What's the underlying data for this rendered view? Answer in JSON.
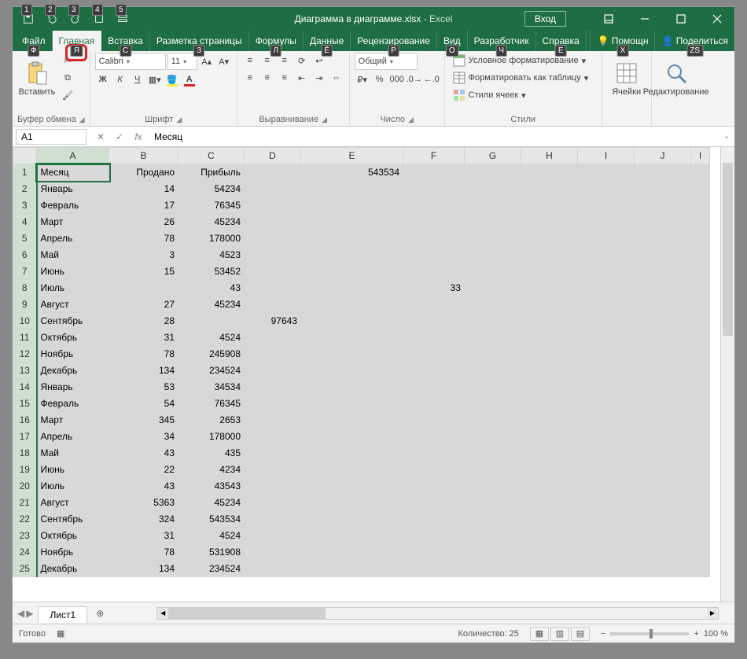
{
  "title": {
    "doc": "Диаграмма в диаграмме.xlsx",
    "sep": "  -  ",
    "app": "Excel"
  },
  "login": "Вход",
  "qat_keys": [
    "1",
    "2",
    "3",
    "4",
    "5"
  ],
  "tabs": [
    {
      "label": "Файл",
      "key": "Ф"
    },
    {
      "label": "Главная",
      "key": "Я",
      "active": true,
      "hl": true
    },
    {
      "label": "Вставка",
      "key": "С"
    },
    {
      "label": "Разметка страницы",
      "key": "З"
    },
    {
      "label": "Формулы",
      "key": "Л"
    },
    {
      "label": "Данные",
      "key": "Ё"
    },
    {
      "label": "Рецензирование",
      "key": "Р"
    },
    {
      "label": "Вид",
      "key": "О"
    },
    {
      "label": "Разработчик",
      "key": "Ч"
    },
    {
      "label": "Справка",
      "key": "Е"
    }
  ],
  "tabs_right": [
    {
      "label": "Помощн",
      "key": "Х",
      "icon": "bulb"
    },
    {
      "label": "Поделиться",
      "key": "ZS",
      "icon": "share"
    }
  ],
  "ribbon": {
    "clipboard": {
      "paste": "Вставить",
      "label": "Буфер обмена"
    },
    "font": {
      "name": "Calibri",
      "size": "11",
      "label": "Шрифт",
      "bold": "Ж",
      "italic": "К",
      "underline": "Ч"
    },
    "align": {
      "label": "Выравнивание"
    },
    "number": {
      "format": "Общий",
      "label": "Число"
    },
    "styles": {
      "cond": "Условное форматирование",
      "table": "Форматировать как таблицу",
      "cell": "Стили ячеек",
      "label": "Стили"
    },
    "cells": {
      "label": "Ячейки"
    },
    "editing": {
      "label": "Редактирование"
    }
  },
  "namebox": "A1",
  "formula": "Месяц",
  "columns": [
    "A",
    "B",
    "C",
    "D",
    "E",
    "F",
    "G",
    "H",
    "I",
    "J",
    "I"
  ],
  "rows": [
    [
      "Месяц",
      "Продано",
      "Прибыль",
      "",
      "543534",
      "",
      "",
      "",
      "",
      "",
      ""
    ],
    [
      "Январь",
      "14",
      "54234",
      "",
      "",
      "",
      "",
      "",
      "",
      "",
      ""
    ],
    [
      "Февраль",
      "17",
      "76345",
      "",
      "",
      "",
      "",
      "",
      "",
      "",
      ""
    ],
    [
      "Март",
      "26",
      "45234",
      "",
      "",
      "",
      "",
      "",
      "",
      "",
      ""
    ],
    [
      "Апрель",
      "78",
      "178000",
      "",
      "",
      "",
      "",
      "",
      "",
      "",
      ""
    ],
    [
      "Май",
      "3",
      "4523",
      "",
      "",
      "",
      "",
      "",
      "",
      "",
      ""
    ],
    [
      "Июнь",
      "15",
      "53452",
      "",
      "",
      "",
      "",
      "",
      "",
      "",
      ""
    ],
    [
      "Июль",
      "",
      "43",
      "",
      "",
      "33",
      "",
      "",
      "",
      "",
      ""
    ],
    [
      "Август",
      "27",
      "45234",
      "",
      "",
      "",
      "",
      "",
      "",
      "",
      ""
    ],
    [
      "Сентябрь",
      "28",
      "",
      "97643",
      "",
      "",
      "",
      "",
      "",
      "",
      ""
    ],
    [
      "Октябрь",
      "31",
      "4524",
      "",
      "",
      "",
      "",
      "",
      "",
      "",
      ""
    ],
    [
      "Ноябрь",
      "78",
      "245908",
      "",
      "",
      "",
      "",
      "",
      "",
      "",
      ""
    ],
    [
      "Декабрь",
      "134",
      "234524",
      "",
      "",
      "",
      "",
      "",
      "",
      "",
      ""
    ],
    [
      "Январь",
      "53",
      "34534",
      "",
      "",
      "",
      "",
      "",
      "",
      "",
      ""
    ],
    [
      "Февраль",
      "54",
      "76345",
      "",
      "",
      "",
      "",
      "",
      "",
      "",
      ""
    ],
    [
      "Март",
      "345",
      "2653",
      "",
      "",
      "",
      "",
      "",
      "",
      "",
      ""
    ],
    [
      "Апрель",
      "34",
      "178000",
      "",
      "",
      "",
      "",
      "",
      "",
      "",
      ""
    ],
    [
      "Май",
      "43",
      "435",
      "",
      "",
      "",
      "",
      "",
      "",
      "",
      ""
    ],
    [
      "Июнь",
      "22",
      "4234",
      "",
      "",
      "",
      "",
      "",
      "",
      "",
      ""
    ],
    [
      "Июль",
      "43",
      "43543",
      "",
      "",
      "",
      "",
      "",
      "",
      "",
      ""
    ],
    [
      "Август",
      "5363",
      "45234",
      "",
      "",
      "",
      "",
      "",
      "",
      "",
      ""
    ],
    [
      "Сентябрь",
      "324",
      "543534",
      "",
      "",
      "",
      "",
      "",
      "",
      "",
      ""
    ],
    [
      "Октябрь",
      "31",
      "4524",
      "",
      "",
      "",
      "",
      "",
      "",
      "",
      ""
    ],
    [
      "Ноябрь",
      "78",
      "531908",
      "",
      "",
      "",
      "",
      "",
      "",
      "",
      ""
    ],
    [
      "Декабрь",
      "134",
      "234524",
      "",
      "",
      "",
      "",
      "",
      "",
      "",
      ""
    ]
  ],
  "sheet": "Лист1",
  "status": {
    "ready": "Готово",
    "count": "Количество: 25",
    "zoom": "100 %"
  }
}
